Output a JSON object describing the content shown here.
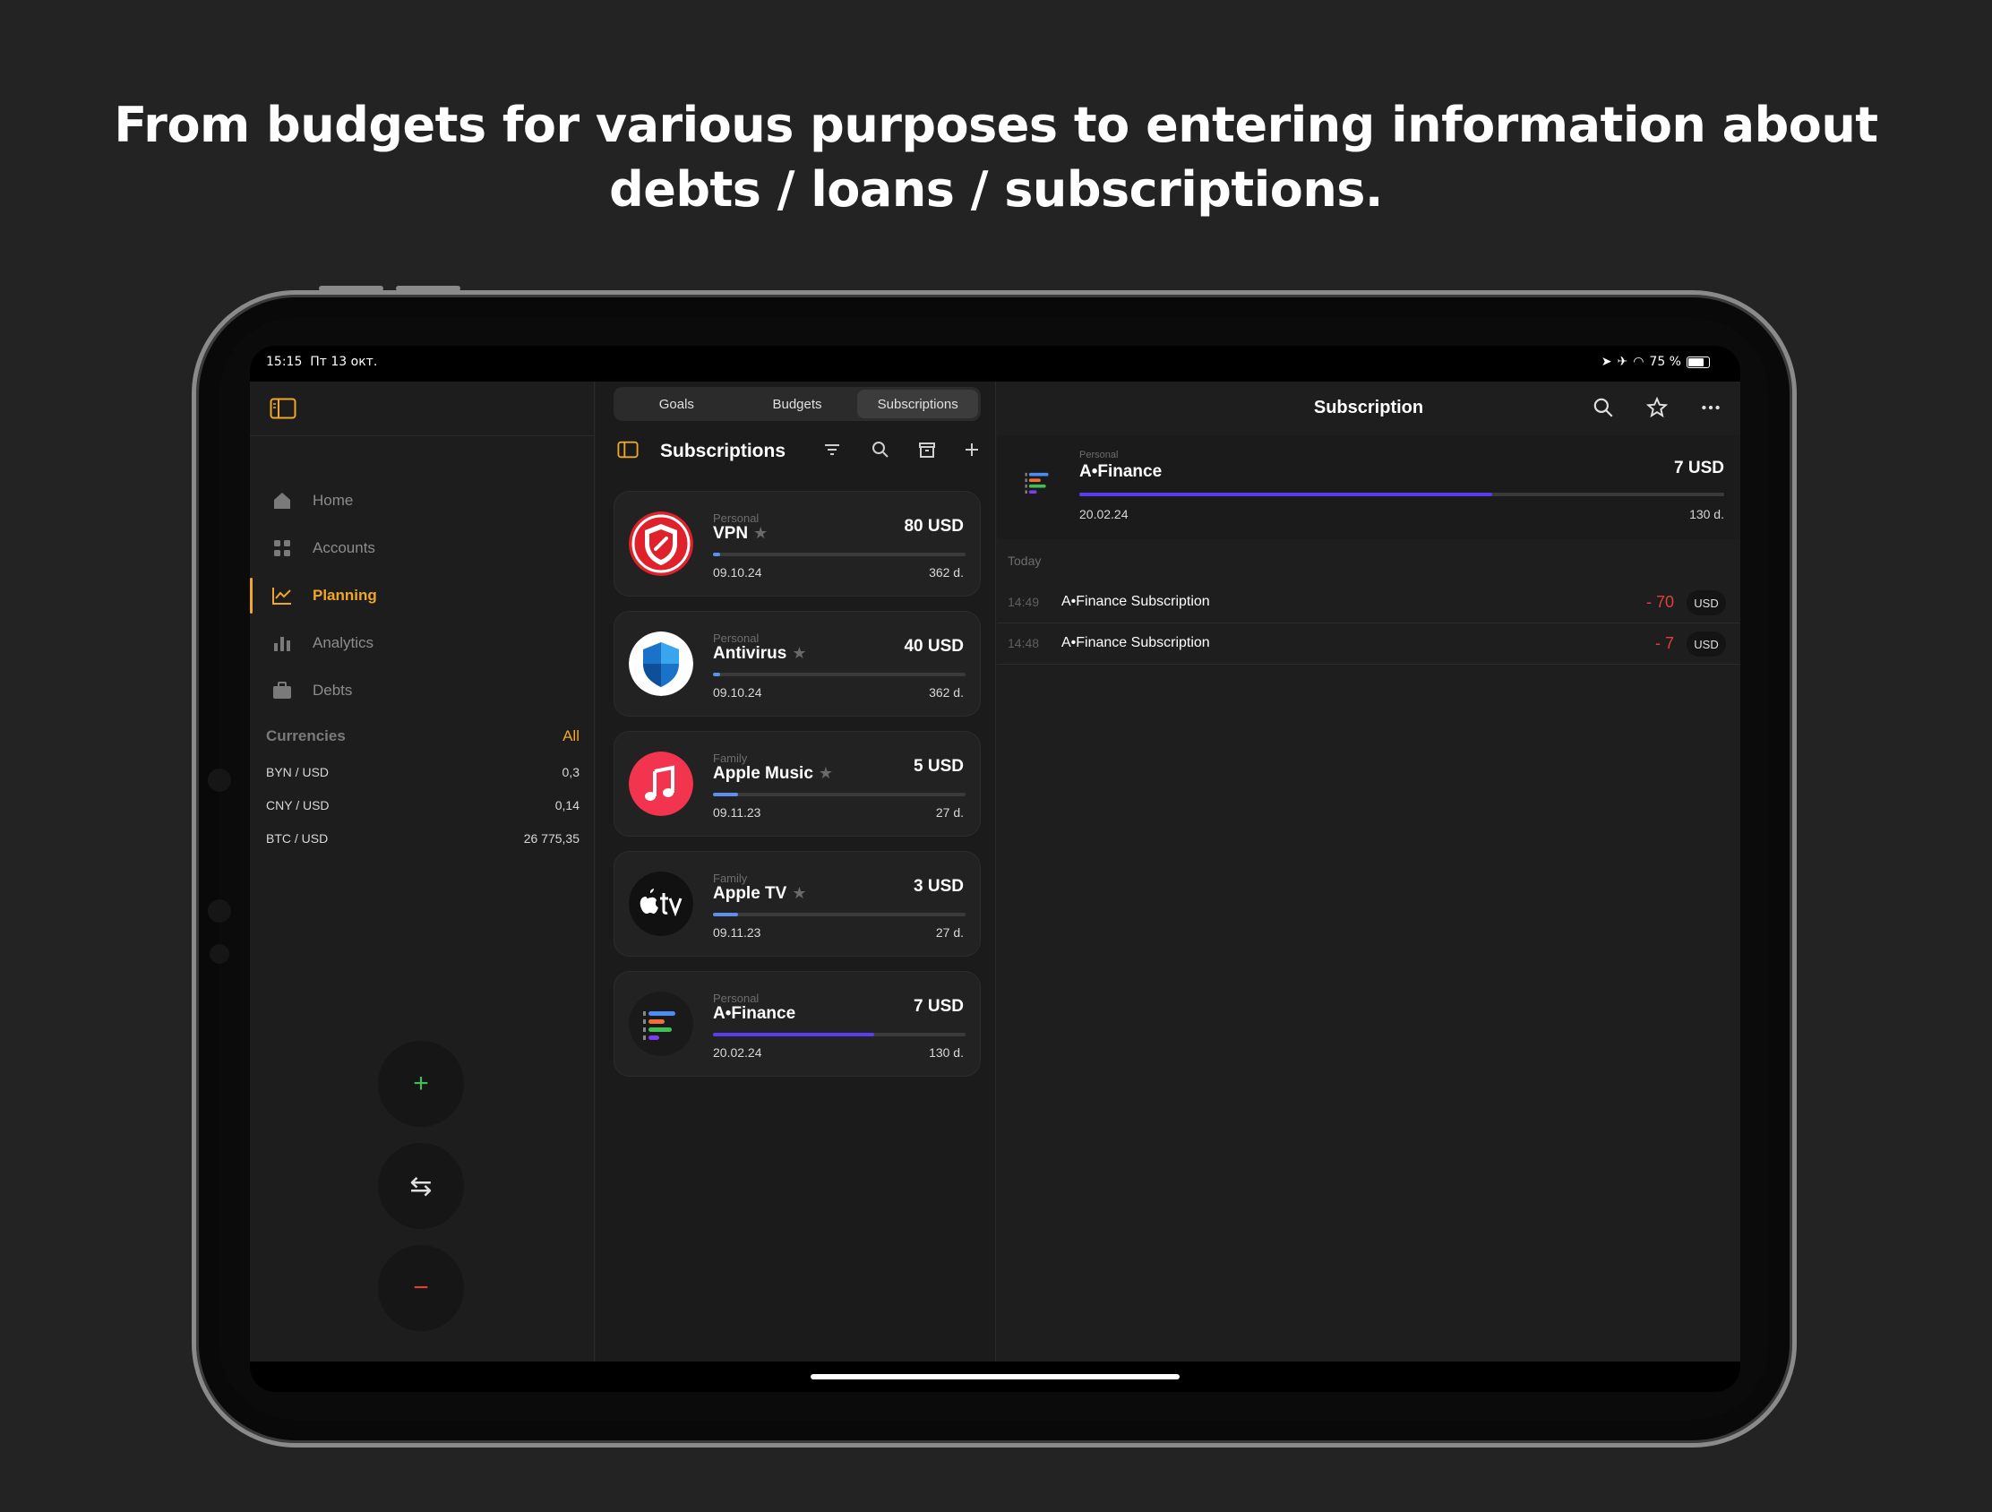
{
  "headline": {
    "line1": "From budgets for various purposes to entering information about",
    "line2": "debts / loans / subscriptions."
  },
  "status_bar": {
    "time": "15:15",
    "date": "Пт 13 окт.",
    "battery": "75 %"
  },
  "sidebar": {
    "nav": [
      {
        "label": "Home",
        "icon": "home-icon"
      },
      {
        "label": "Accounts",
        "icon": "grid-icon"
      },
      {
        "label": "Planning",
        "icon": "chart-line-icon",
        "active": true
      },
      {
        "label": "Analytics",
        "icon": "bar-chart-icon"
      },
      {
        "label": "Debts",
        "icon": "briefcase-icon"
      }
    ],
    "currencies_title": "Currencies",
    "currencies_all": "All",
    "currencies": [
      {
        "pair": "BYN / USD",
        "rate": "0,3"
      },
      {
        "pair": "CNY / USD",
        "rate": "0,14"
      },
      {
        "pair": "BTC / USD",
        "rate": "26 775,35"
      }
    ],
    "fab_add": "+",
    "fab_transfer": "⇆",
    "fab_remove": "−"
  },
  "tabs": [
    "Goals",
    "Budgets",
    "Subscriptions"
  ],
  "list": {
    "title": "Subscriptions",
    "items": [
      {
        "group": "Personal",
        "name": "VPN",
        "star": "★",
        "amount": "80 USD",
        "date": "09.10.24",
        "days": "362 d.",
        "progress": 0.03,
        "bar_color": "#5b8ff0"
      },
      {
        "group": "Personal",
        "name": "Antivirus",
        "star": "★",
        "amount": "40 USD",
        "date": "09.10.24",
        "days": "362 d.",
        "progress": 0.03,
        "bar_color": "#5b8ff0"
      },
      {
        "group": "Family",
        "name": "Apple Music",
        "star": "★",
        "amount": "5 USD",
        "date": "09.11.23",
        "days": "27 d.",
        "progress": 0.1,
        "bar_color": "#5b8ff0"
      },
      {
        "group": "Family",
        "name": "Apple TV",
        "star": "★",
        "amount": "3 USD",
        "date": "09.11.23",
        "days": "27 d.",
        "progress": 0.1,
        "bar_color": "#5b8ff0"
      },
      {
        "group": "Personal",
        "name": "A•Finance",
        "star": "",
        "amount": "7 USD",
        "date": "20.02.24",
        "days": "130 d.",
        "progress": 0.64,
        "bar_color": "#5a3df0"
      }
    ]
  },
  "detail": {
    "title": "Subscription",
    "group": "Personal",
    "name": "A•Finance",
    "amount": "7 USD",
    "date": "20.02.24",
    "days": "130 d.",
    "progress": 0.64,
    "section": "Today",
    "transactions": [
      {
        "time": "14:49",
        "name": "A•Finance Subscription",
        "value": "- 70",
        "currency": "USD"
      },
      {
        "time": "14:48",
        "name": "A•Finance Subscription",
        "value": "- 7",
        "currency": "USD"
      }
    ]
  },
  "colors": {
    "accent": "#f0a727",
    "negative": "#e0403a",
    "progress": "#5b8ff0",
    "progress_alt": "#5a3df0"
  }
}
